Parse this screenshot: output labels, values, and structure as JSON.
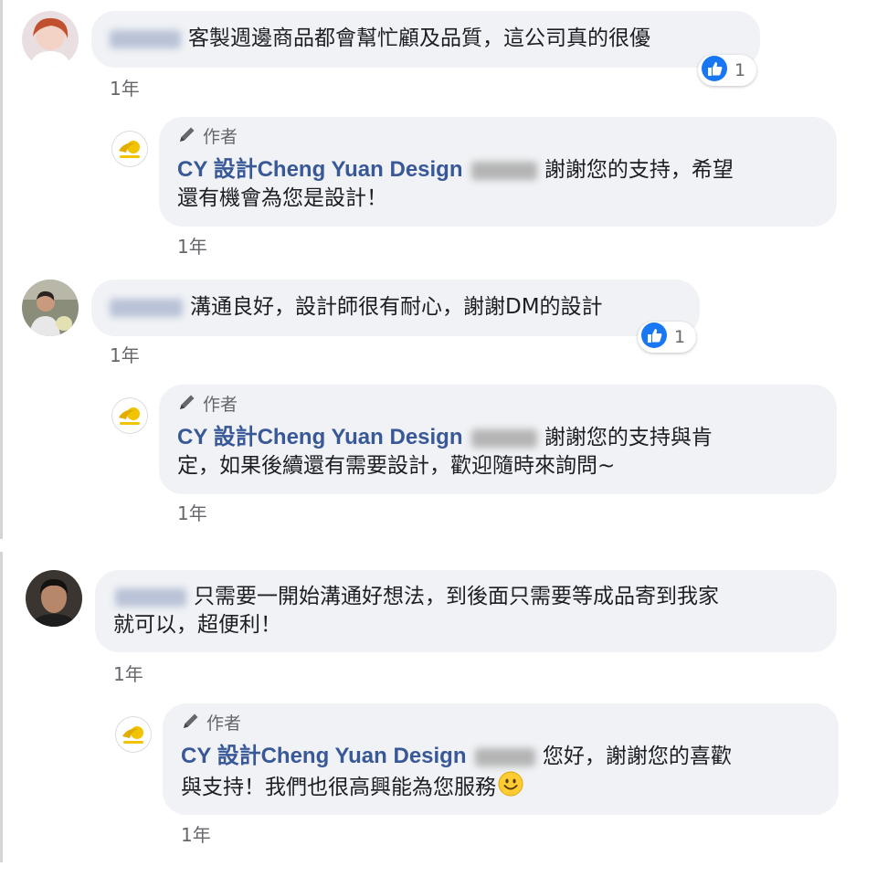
{
  "author_label": "作者",
  "page_name": "CY 設計Cheng Yuan Design",
  "time_label": "1年",
  "colors": {
    "page_link": "#385898",
    "bubble": "#f0f2f5",
    "like_blue": "#1877f2"
  },
  "comments": [
    {
      "text": "客製週邊商品都會幫忙顧及品質，這公司真的很優",
      "time": "1年",
      "reactions": {
        "icon": "like-icon",
        "count": "1"
      },
      "reply": {
        "author_tag": "作者",
        "page_name": "CY 設計Cheng Yuan Design",
        "line1": "謝謝您的支持，希望",
        "line2": "還有機會為您是設計！",
        "time": "1年"
      }
    },
    {
      "text": "溝通良好，設計師很有耐心，謝謝DM的設計",
      "time": "1年",
      "reactions": {
        "icon": "like-icon",
        "count": "1"
      },
      "reply": {
        "author_tag": "作者",
        "page_name": "CY 設計Cheng Yuan Design",
        "line1": "謝謝您的支持與肯",
        "line2": "定，如果後續還有需要設計，歡迎隨時來詢問~",
        "time": "1年"
      }
    },
    {
      "text_line1": "只需要一開始溝通好想法，到後面只需要等成品寄到我家",
      "text_line2": "就可以，超便利！",
      "time": "1年",
      "reply": {
        "author_tag": "作者",
        "page_name": "CY 設計Cheng Yuan Design",
        "line1": "您好，謝謝您的喜歡",
        "line2": "與支持！我們也很高興能為您服務",
        "emoji": "smile-emoji",
        "time": "1年"
      }
    }
  ]
}
